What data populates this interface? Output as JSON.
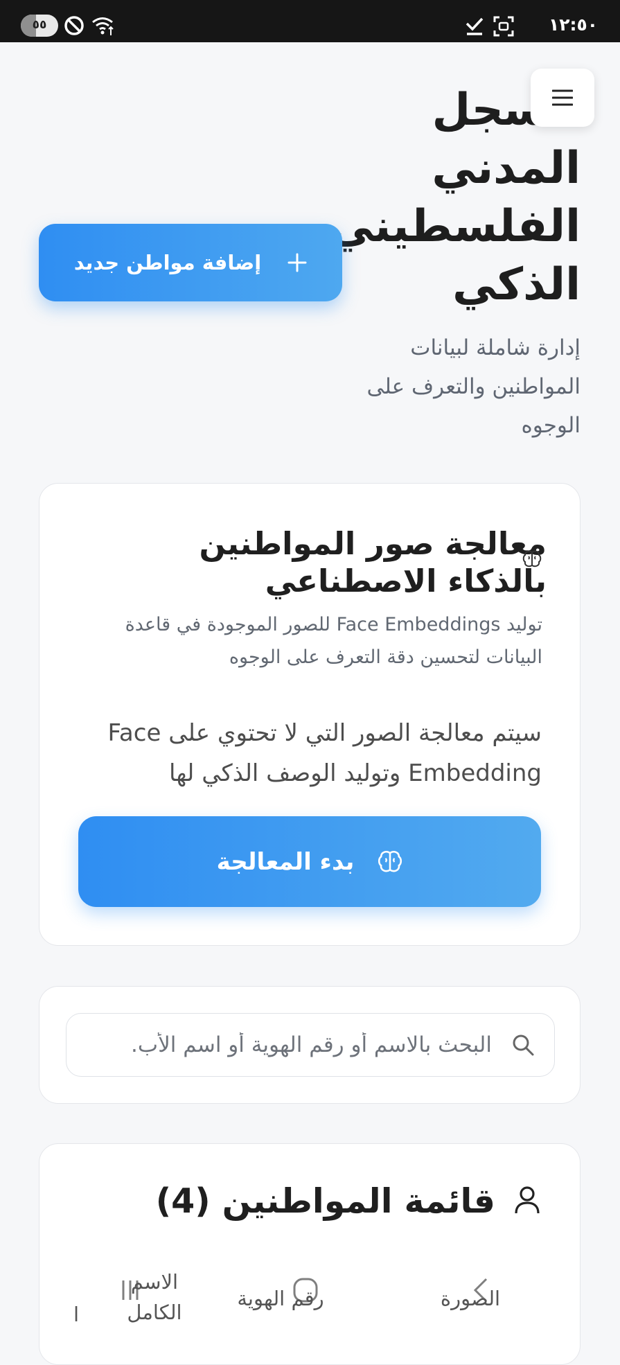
{
  "status_bar": {
    "battery": "٥٥",
    "time": "١٢:٥٠"
  },
  "header": {
    "title": "السجل المدني الفلسطيني الذكي",
    "subtitle": "إدارة شاملة لبيانات المواطنين والتعرف على الوجوه",
    "add_button_label": "إضافة مواطن جديد"
  },
  "ai_card": {
    "title": "معالجة صور المواطنين بالذكاء الاصطناعي",
    "description": "توليد Face Embeddings للصور الموجودة في قاعدة البيانات لتحسين دقة التعرف على الوجوه",
    "info": "سيتم معالجة الصور التي لا تحتوي على Face Embedding وتوليد الوصف الذكي لها",
    "button_label": "بدء المعالجة"
  },
  "search": {
    "placeholder": "البحث بالاسم أو رقم الهوية أو اسم الأب.",
    "value": ""
  },
  "citizens_list": {
    "title": "قائمة المواطنين (4)",
    "columns": [
      "الصورة",
      "رقم الهوية",
      "الاسم الكامل",
      "ا"
    ]
  },
  "colors": {
    "accent": "#2f8ef2",
    "accent_light": "#52aaef",
    "background": "#f6f7f9",
    "status_bar": "#161616"
  },
  "icons": [
    "menu-icon",
    "plus-icon",
    "brain-icon",
    "search-icon",
    "user-icon"
  ]
}
